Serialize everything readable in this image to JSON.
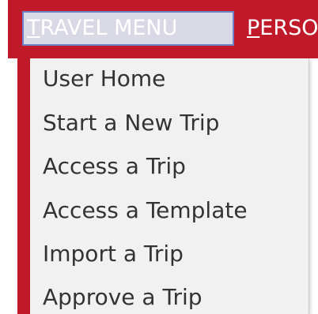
{
  "nav": {
    "active_tab": {
      "first": "T",
      "rest": "RAVEL MENU"
    },
    "next_tab": {
      "first": "P",
      "rest": "ERSO"
    }
  },
  "menu": {
    "items": [
      {
        "label": "User Home"
      },
      {
        "label": "Start a New Trip"
      },
      {
        "label": "Access a Trip"
      },
      {
        "label": "Access a Template"
      },
      {
        "label": "Import a Trip"
      },
      {
        "label": "Approve a Trip"
      }
    ]
  },
  "colors": {
    "brand_red": "#c01a2a",
    "menu_bg": "#f1f1f1",
    "active_tab_bg": "#d9d9e6"
  }
}
